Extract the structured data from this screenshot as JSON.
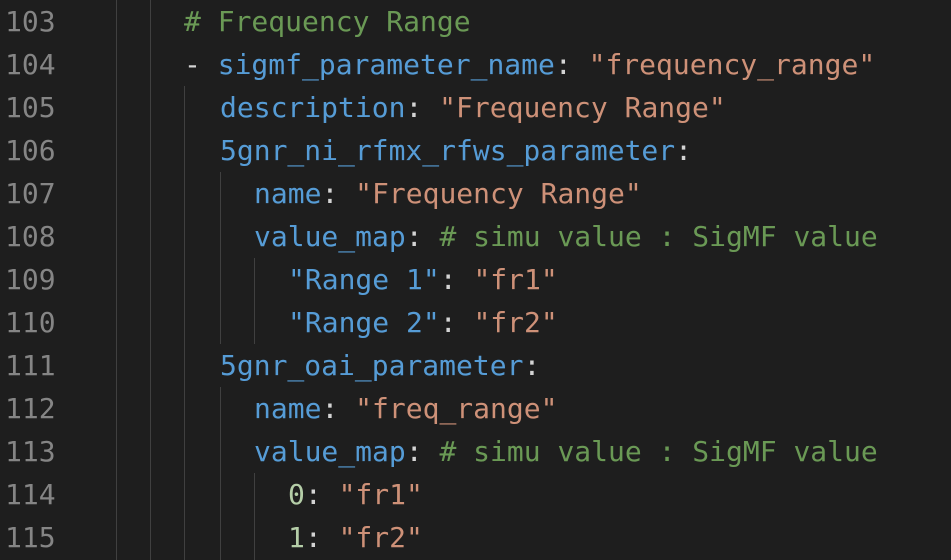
{
  "editor": {
    "lines": [
      {
        "num": "103",
        "tokens": [
          {
            "t": "# Frequency Range",
            "c": "cmt"
          }
        ]
      },
      {
        "num": "104",
        "tokens": [
          {
            "t": "- ",
            "c": "pun"
          },
          {
            "t": "sigmf_parameter_name",
            "c": "key"
          },
          {
            "t": ": ",
            "c": "pun"
          },
          {
            "t": "\"frequency_range\"",
            "c": "str"
          }
        ]
      },
      {
        "num": "105",
        "tokens": [
          {
            "t": "description",
            "c": "key"
          },
          {
            "t": ": ",
            "c": "pun"
          },
          {
            "t": "\"Frequency Range\"",
            "c": "str"
          }
        ]
      },
      {
        "num": "106",
        "tokens": [
          {
            "t": "5gnr_ni_rfmx_rfws_parameter",
            "c": "key"
          },
          {
            "t": ":",
            "c": "pun"
          }
        ]
      },
      {
        "num": "107",
        "tokens": [
          {
            "t": "name",
            "c": "key"
          },
          {
            "t": ": ",
            "c": "pun"
          },
          {
            "t": "\"Frequency Range\"",
            "c": "str"
          }
        ]
      },
      {
        "num": "108",
        "tokens": [
          {
            "t": "value_map",
            "c": "key"
          },
          {
            "t": ": ",
            "c": "pun"
          },
          {
            "t": "# simu value : SigMF value",
            "c": "cmt"
          }
        ]
      },
      {
        "num": "109",
        "tokens": [
          {
            "t": "\"Range 1\"",
            "c": "key"
          },
          {
            "t": ": ",
            "c": "pun"
          },
          {
            "t": "\"fr1\"",
            "c": "str"
          }
        ]
      },
      {
        "num": "110",
        "tokens": [
          {
            "t": "\"Range 2\"",
            "c": "key"
          },
          {
            "t": ": ",
            "c": "pun"
          },
          {
            "t": "\"fr2\"",
            "c": "str"
          }
        ]
      },
      {
        "num": "111",
        "tokens": [
          {
            "t": "5gnr_oai_parameter",
            "c": "key"
          },
          {
            "t": ":",
            "c": "pun"
          }
        ]
      },
      {
        "num": "112",
        "tokens": [
          {
            "t": "name",
            "c": "key"
          },
          {
            "t": ": ",
            "c": "pun"
          },
          {
            "t": "\"freq_range\"",
            "c": "str"
          }
        ]
      },
      {
        "num": "113",
        "tokens": [
          {
            "t": "value_map",
            "c": "key"
          },
          {
            "t": ": ",
            "c": "pun"
          },
          {
            "t": "# simu value : SigMF value",
            "c": "cmt"
          }
        ]
      },
      {
        "num": "114",
        "tokens": [
          {
            "t": "0",
            "c": "num"
          },
          {
            "t": ": ",
            "c": "pun"
          },
          {
            "t": "\"fr1\"",
            "c": "str"
          }
        ]
      },
      {
        "num": "115",
        "tokens": [
          {
            "t": "1",
            "c": "num"
          },
          {
            "t": ": ",
            "c": "pun"
          },
          {
            "t": "\"fr2\"",
            "c": "str"
          }
        ]
      }
    ]
  }
}
